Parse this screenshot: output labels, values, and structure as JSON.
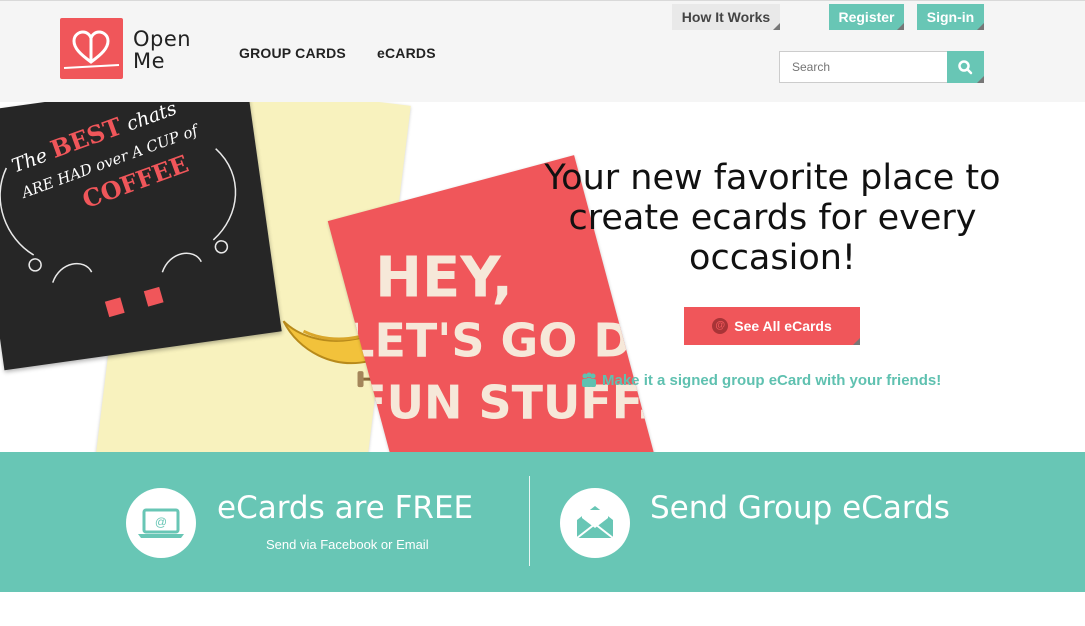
{
  "brand": {
    "name_line1": "Open",
    "name_line2": "Me",
    "logo_icon": "heart-card-icon"
  },
  "nav": {
    "group_cards": "GROUP CARDS",
    "ecards": "eCARDS"
  },
  "header": {
    "how_it_works": "How It Works",
    "register": "Register",
    "sign_in": "Sign-in",
    "search_placeholder": "Search",
    "search_icon": "search-icon"
  },
  "hero": {
    "title": "Your new favorite place to create ecards for every occasion!",
    "see_all_button": "See All eCards",
    "group_link": "Make it a signed group eCard with your friends!",
    "card_black": {
      "line1": "The",
      "best": "BEST",
      "line2": "chats",
      "line3": "ARE HAD over A CUP of",
      "coffee": "COFFEE"
    },
    "card_red": {
      "line1": "HEY,",
      "line2": "LET'S GO DO",
      "line3": "FUN STUFF."
    }
  },
  "features": [
    {
      "title": "eCards are FREE",
      "subtitle": "Send via Facebook or Email",
      "icon": "laptop-email-icon"
    },
    {
      "title": "Send Group eCards",
      "icon": "envelope-open-icon"
    }
  ],
  "colors": {
    "teal": "#68c6b5",
    "coral": "#f0565a",
    "header_bg": "#f5f5f5"
  }
}
